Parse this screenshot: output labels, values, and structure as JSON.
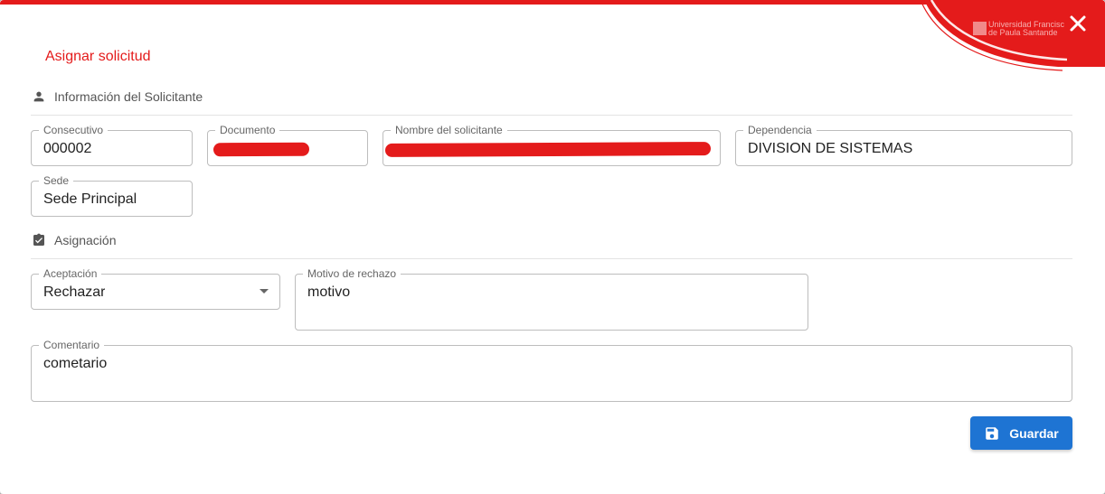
{
  "dialog": {
    "title": "Asignar solicitud",
    "logo": {
      "line1": "Universidad Francisc",
      "line2": "de Paula Santande"
    }
  },
  "colors": {
    "accent": "#e41b1b",
    "primary_button": "#1e74d3"
  },
  "icons": {
    "close": "close-icon",
    "person": "person-icon",
    "assignment": "assignment-check-icon",
    "save": "save-icon",
    "dropdown": "arrow-drop-down-icon"
  },
  "sections": {
    "solicitante": {
      "title": "Información del Solicitante"
    },
    "asignacion": {
      "title": "Asignación"
    }
  },
  "fields": {
    "consecutivo": {
      "label": "Consecutivo",
      "value": "000002"
    },
    "documento": {
      "label": "Documento",
      "value": ""
    },
    "nombre": {
      "label": "Nombre del solicitante",
      "value": ""
    },
    "dependencia": {
      "label": "Dependencia",
      "value": "DIVISION DE SISTEMAS"
    },
    "sede": {
      "label": "Sede",
      "value": "Sede Principal"
    },
    "aceptacion": {
      "label": "Aceptación",
      "value": "Rechazar"
    },
    "motivo": {
      "label": "Motivo de rechazo",
      "value": "motivo"
    },
    "comentario": {
      "label": "Comentario",
      "value": "cometario"
    }
  },
  "actions": {
    "save_label": "Guardar"
  }
}
